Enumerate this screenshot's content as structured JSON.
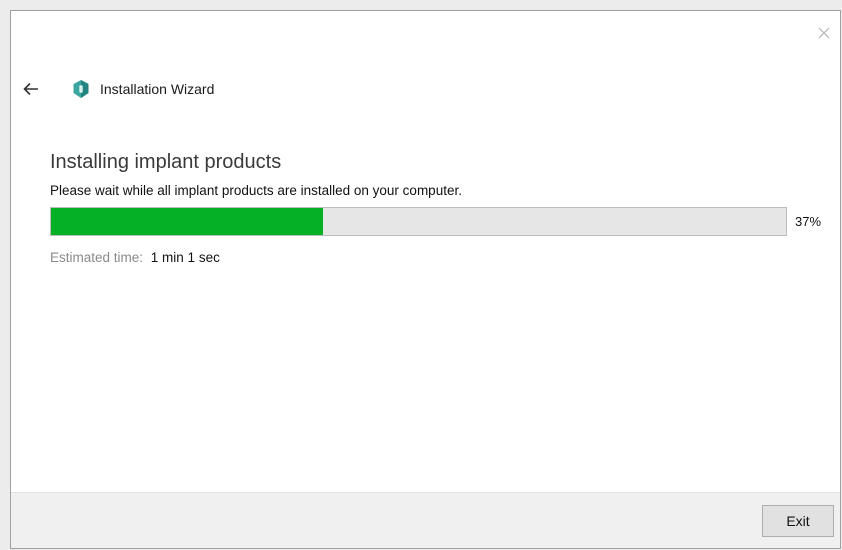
{
  "window": {
    "title": "Installation Wizard"
  },
  "icons": {
    "back": "arrow-left-icon",
    "app": "shield-icon",
    "close": "close-icon"
  },
  "main": {
    "title": "Installing implant products",
    "subtitle": "Please wait while all implant products are installed on your computer.",
    "progress": {
      "percent": 37,
      "label": "37%",
      "fill_color": "#06b025"
    },
    "estimate": {
      "label": "Estimated time:",
      "value": "1 min 1 sec"
    }
  },
  "footer": {
    "exit_label": "Exit"
  }
}
